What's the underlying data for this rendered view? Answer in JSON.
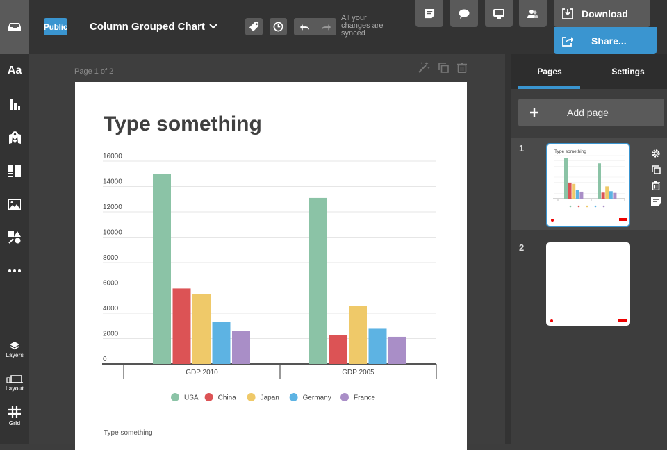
{
  "topbar": {
    "visibility_badge": "Public",
    "document_title": "Column Grouped Chart",
    "sync_status": "All your changes are synced",
    "download_label": "Download",
    "share_label": "Share...",
    "icons": [
      "inbox-icon",
      "tag-icon",
      "history-icon",
      "undo-icon",
      "redo-icon",
      "notes-icon",
      "comment-icon",
      "present-icon",
      "collaborators-icon",
      "download-icon",
      "share-icon"
    ]
  },
  "left_nav": {
    "items": [
      {
        "name": "text",
        "icon": "text-icon",
        "label": ""
      },
      {
        "name": "charts",
        "icon": "chart-icon",
        "label": ""
      },
      {
        "name": "maps",
        "icon": "map-icon",
        "label": ""
      },
      {
        "name": "layouts",
        "icon": "layout-blocks-icon",
        "label": ""
      },
      {
        "name": "photos",
        "icon": "image-icon",
        "label": ""
      },
      {
        "name": "shapes",
        "icon": "shapes-icon",
        "label": ""
      },
      {
        "name": "more",
        "icon": "more-icon",
        "label": ""
      }
    ],
    "bottom_items": [
      {
        "name": "layers",
        "icon": "layers-icon",
        "label": "Layers"
      },
      {
        "name": "layout",
        "icon": "device-icon",
        "label": "Layout"
      },
      {
        "name": "grid",
        "icon": "grid-icon",
        "label": "Grid"
      }
    ]
  },
  "canvas": {
    "page_indicator": "Page 1 of 2",
    "page_title": "Type something",
    "footer_text": "Type something"
  },
  "right_panel": {
    "tabs": [
      {
        "label": "Pages",
        "active": true
      },
      {
        "label": "Settings",
        "active": false
      }
    ],
    "add_page_label": "Add page",
    "pages": [
      {
        "number": "1",
        "active": true,
        "thumb_title": "Type something"
      },
      {
        "number": "2",
        "active": false,
        "thumb_title": ""
      }
    ]
  },
  "chart_data": {
    "type": "bar",
    "title": "",
    "xlabel": "",
    "ylabel": "",
    "categories": [
      "GDP 2010",
      "GDP 2005"
    ],
    "series": [
      {
        "name": "USA",
        "color": "#8bc3a6",
        "values": [
          15000,
          13100
        ]
      },
      {
        "name": "China",
        "color": "#dc5355",
        "values": [
          5950,
          2250
        ]
      },
      {
        "name": "Japan",
        "color": "#efc969",
        "values": [
          5480,
          4550
        ]
      },
      {
        "name": "Germany",
        "color": "#5db3e3",
        "values": [
          3340,
          2770
        ]
      },
      {
        "name": "France",
        "color": "#a98ec7",
        "values": [
          2600,
          2140
        ]
      }
    ],
    "ylim": [
      0,
      16000
    ],
    "yticks": [
      0,
      2000,
      4000,
      6000,
      8000,
      10000,
      12000,
      14000,
      16000
    ],
    "grid": true,
    "legend_position": "bottom"
  }
}
